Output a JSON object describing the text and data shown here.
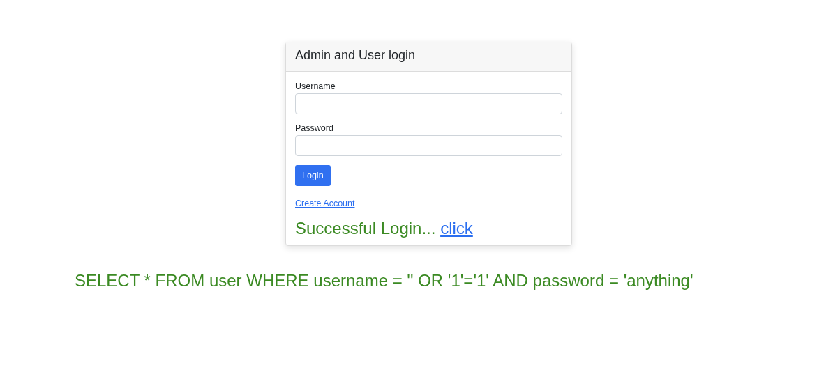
{
  "card": {
    "title": "Admin and User login"
  },
  "fields": [
    {
      "label": "Username"
    },
    {
      "label": "Password"
    }
  ],
  "login_button": "Login",
  "create_account_link": "Create Account",
  "success": {
    "message": "Successful Login...",
    "link": "click"
  },
  "query": "SELECT * FROM user WHERE username = '' OR '1'='1' AND password = 'anything'"
}
